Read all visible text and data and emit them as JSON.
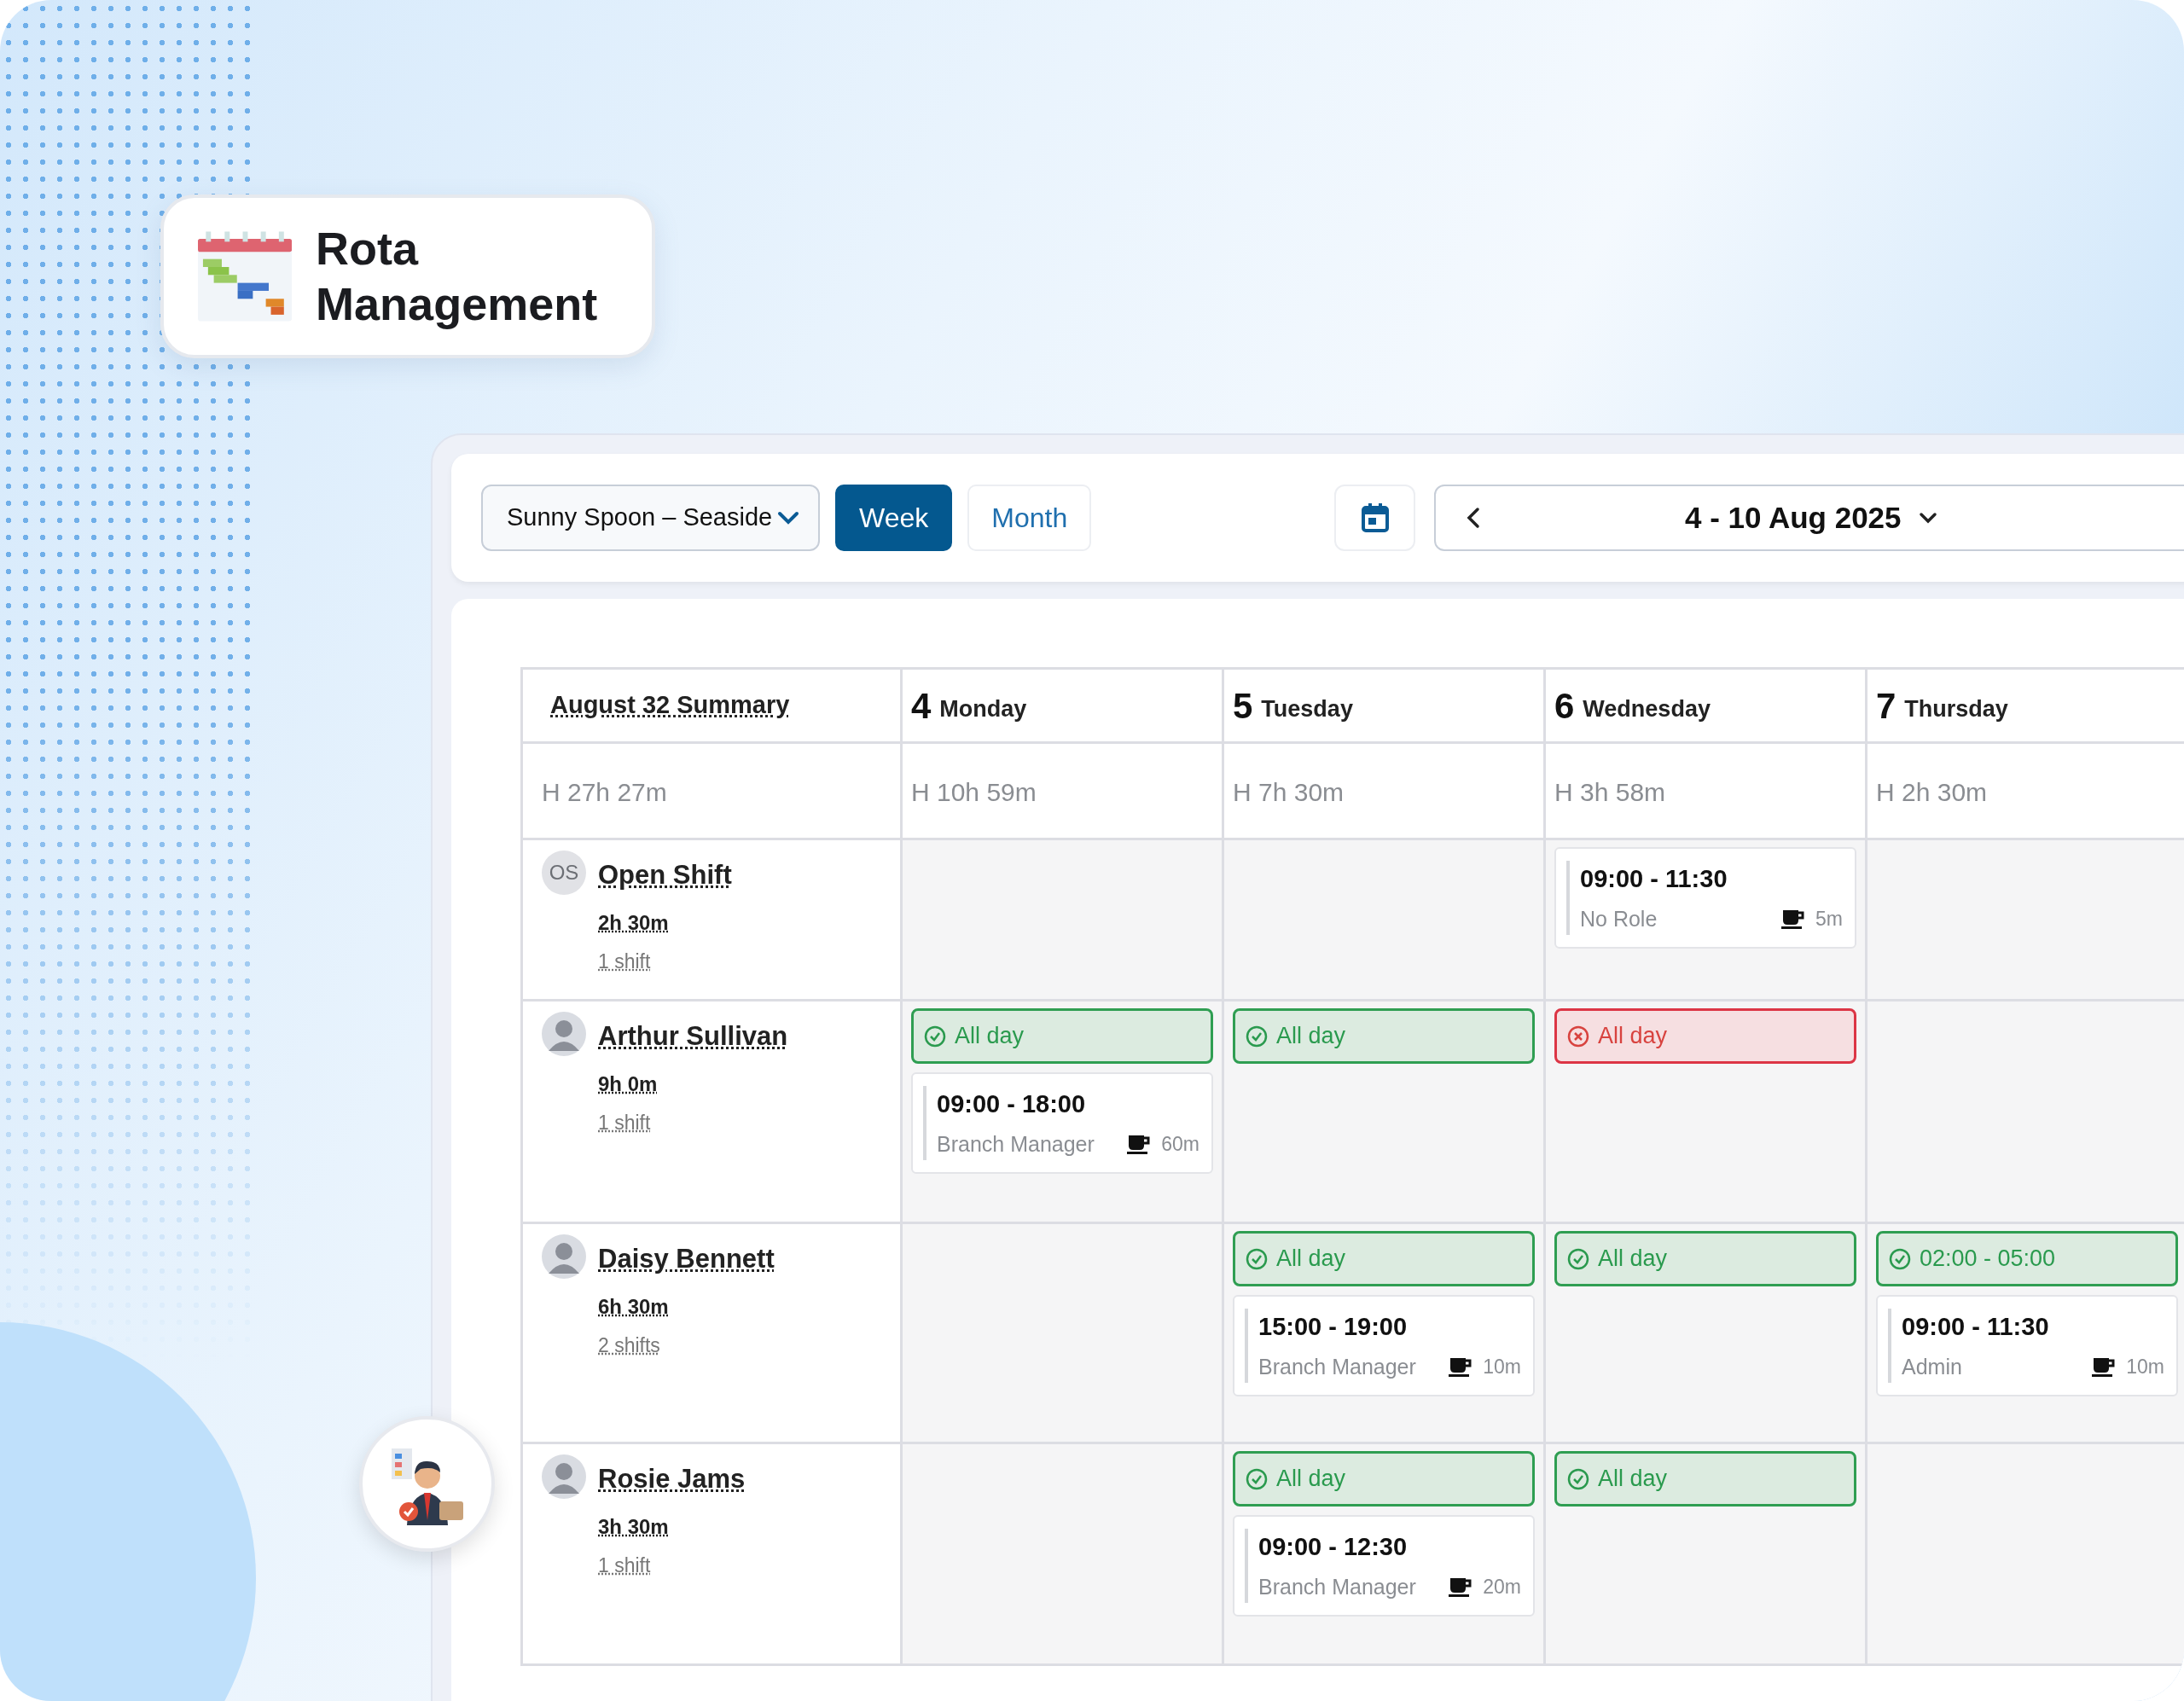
{
  "logo_card": {
    "title": "Rota Management"
  },
  "toolbar": {
    "location_select": "Sunny Spoon – Seaside",
    "view_tabs": [
      {
        "label": "Week",
        "selected": true
      },
      {
        "label": "Month",
        "selected": false
      }
    ],
    "date_range": "4 - 10 Aug 2025"
  },
  "schedule": {
    "summary_title": "August 32 Summary",
    "summary_hours": "H 27h 27m",
    "days": [
      {
        "number": "4",
        "name": "Monday",
        "hours": "H 10h 59m"
      },
      {
        "number": "5",
        "name": "Tuesday",
        "hours": "H 7h 30m"
      },
      {
        "number": "6",
        "name": "Wednesday",
        "hours": "H 3h 58m"
      },
      {
        "number": "7",
        "name": "Thursday",
        "hours": "H 2h 30m"
      }
    ],
    "rows": [
      {
        "name": "Open Shift",
        "avatar": {
          "kind": "initials",
          "text": "OS"
        },
        "hours": "2h 30m",
        "shifts": "1 shift",
        "cells": [
          [],
          [],
          [
            {
              "kind": "shift",
              "time": "09:00 - 11:30",
              "role": "No Role",
              "break": "5m"
            }
          ],
          []
        ]
      },
      {
        "name": "Arthur Sullivan",
        "avatar": {
          "kind": "picture"
        },
        "hours": "9h 0m",
        "shifts": "1 shift",
        "cells": [
          [
            {
              "kind": "availability",
              "available": true,
              "label": "All day"
            },
            {
              "kind": "shift",
              "time": "09:00 - 18:00",
              "role": "Branch Manager",
              "break": "60m"
            }
          ],
          [
            {
              "kind": "availability",
              "available": true,
              "label": "All day"
            }
          ],
          [
            {
              "kind": "availability",
              "available": false,
              "label": "All day"
            }
          ],
          []
        ]
      },
      {
        "name": "Daisy Bennett",
        "avatar": {
          "kind": "picture"
        },
        "hours": "6h 30m",
        "shifts": "2 shifts",
        "cells": [
          [],
          [
            {
              "kind": "availability",
              "available": true,
              "label": "All day"
            },
            {
              "kind": "shift",
              "time": "15:00 - 19:00",
              "role": "Branch Manager",
              "break": "10m"
            }
          ],
          [
            {
              "kind": "availability",
              "available": true,
              "label": "All day"
            }
          ],
          [
            {
              "kind": "availability",
              "available": true,
              "label": "02:00 - 05:00"
            },
            {
              "kind": "shift",
              "time": "09:00 - 11:30",
              "role": "Admin",
              "break": "10m"
            }
          ]
        ]
      },
      {
        "name": "Rosie Jams",
        "avatar": {
          "kind": "picture"
        },
        "hours": "3h 30m",
        "shifts": "1 shift",
        "cells": [
          [],
          [
            {
              "kind": "availability",
              "available": true,
              "label": "All day"
            },
            {
              "kind": "shift",
              "time": "09:00 - 12:30",
              "role": "Branch Manager",
              "break": "20m"
            }
          ],
          [
            {
              "kind": "availability",
              "available": true,
              "label": "All day"
            }
          ],
          []
        ]
      }
    ]
  }
}
